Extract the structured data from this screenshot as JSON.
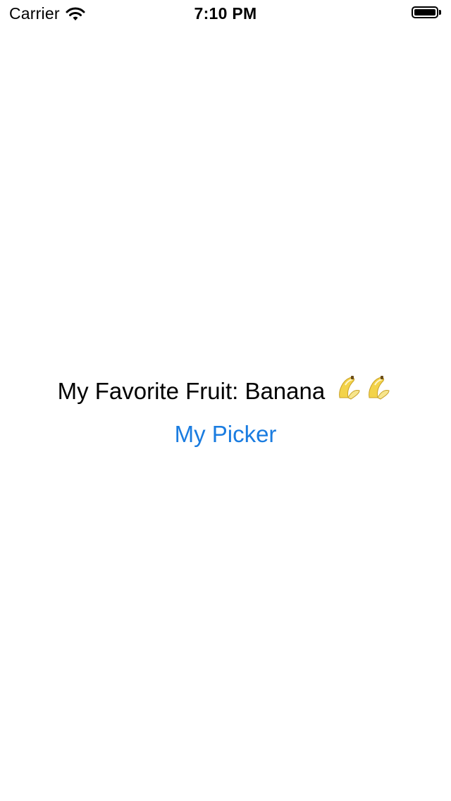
{
  "status_bar": {
    "carrier": "Carrier",
    "time": "7:10 PM",
    "wifi_icon": "wifi-icon",
    "battery_icon": "battery-icon",
    "battery_level": 1.0
  },
  "main": {
    "favorite_label": "My Favorite Fruit: Banana",
    "favorite_emoji_icon": "banana-icon",
    "picker_button_label": "My Picker",
    "accent_color": "#1a7ce0"
  }
}
